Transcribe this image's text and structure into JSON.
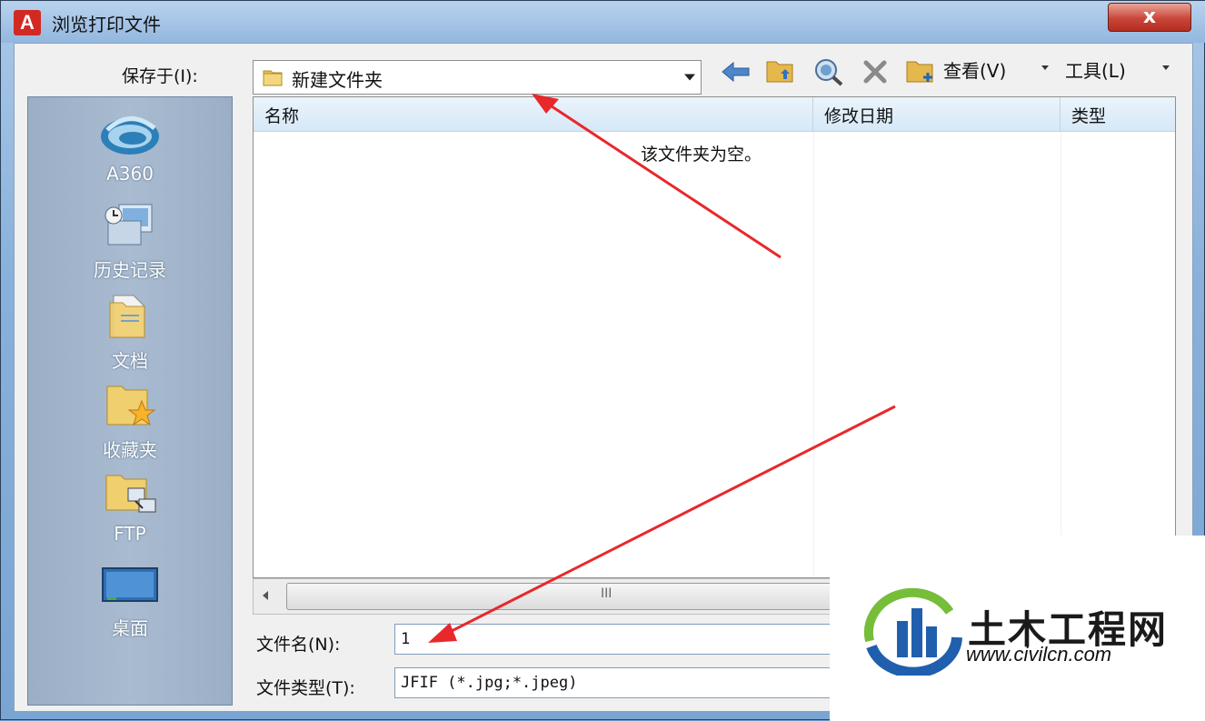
{
  "window": {
    "title": "浏览打印文件",
    "app_icon": "autocad-a-icon",
    "close_label": "x"
  },
  "location_bar": {
    "label": "保存于(I):",
    "current_folder": "新建文件夹"
  },
  "toolbar": {
    "back": "back-arrow-icon",
    "up_folder": "up-folder-icon",
    "search_web": "search-web-icon",
    "delete": "delete-icon",
    "new_folder": "new-folder-icon",
    "view_label": "查看(V)",
    "tools_label": "工具(L)"
  },
  "places": [
    {
      "label": "A360",
      "icon": "a360-cloud-icon"
    },
    {
      "label": "历史记录",
      "icon": "history-icon"
    },
    {
      "label": "文档",
      "icon": "documents-folder-icon"
    },
    {
      "label": "收藏夹",
      "icon": "favorites-folder-icon"
    },
    {
      "label": "FTP",
      "icon": "ftp-icon"
    },
    {
      "label": "桌面",
      "icon": "desktop-icon"
    }
  ],
  "file_list": {
    "columns": [
      "名称",
      "修改日期",
      "类型"
    ],
    "empty_message": "该文件夹为空。"
  },
  "file_name": {
    "label": "文件名(N):",
    "value": "1"
  },
  "file_type": {
    "label": "文件类型(T):",
    "value": "JFIF (*.jpg;*.jpeg)"
  },
  "scrollbar": {
    "grip": "III"
  },
  "watermark": {
    "brand": "土木工程网",
    "url": "www.civilcn.com"
  },
  "colors": {
    "annotation_arrow": "#e8282b",
    "title_bar": "#9fc0e4",
    "close_button": "#c9463a"
  }
}
